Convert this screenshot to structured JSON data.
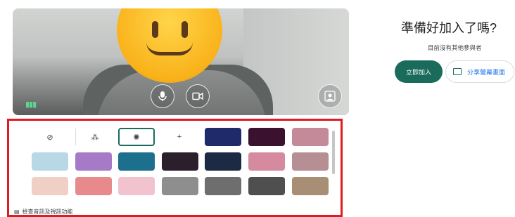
{
  "right_panel": {
    "title": "準備好加入了嗎?",
    "subtitle": "目前沒有其他參與者",
    "join_label": "立即加入",
    "present_label": "分享螢幕畫面"
  },
  "preview": {
    "mic_icon": "mic-icon",
    "camera_icon": "camera-icon",
    "effects_icon": "person-effects-icon",
    "audio_icon": "audio-level-icon"
  },
  "effects": {
    "options": [
      {
        "name": "no-effect",
        "glyph": "⊘"
      },
      {
        "name": "slight-blur",
        "glyph": "⁂"
      },
      {
        "name": "blur",
        "glyph": "✺"
      },
      {
        "name": "add-background",
        "glyph": "+"
      }
    ],
    "selected": "blur",
    "row1_backgrounds": [
      "#1f2a6b",
      "#3a1230",
      "#c48a9a"
    ],
    "row2_backgrounds": [
      "#b9d8e6",
      "#a77ac8",
      "#1d6f8e",
      "#2a1f2a",
      "#1c2a44",
      "#d58aa0",
      "#b58f93"
    ],
    "row3_backgrounds": [
      "#f0cfc6",
      "#e88a8c",
      "#f1c3ce",
      "#8e8e8e",
      "#6e6e6e",
      "#4f4f4f",
      "#a88e74",
      "#b9a99a"
    ],
    "footer_label": "檢查音訊及視訊功能"
  },
  "colors": {
    "accent": "#1a6b5c",
    "highlight_border": "#e01b24"
  }
}
